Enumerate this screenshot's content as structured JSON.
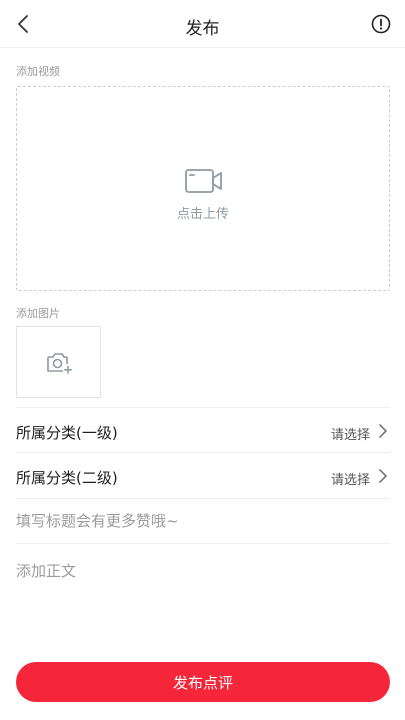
{
  "header": {
    "title": "发布",
    "back_icon": "chevron-left-icon",
    "info_icon": "exclamation-circle-icon"
  },
  "video": {
    "section_label": "添加视频",
    "upload_text": "点击上传",
    "icon": "video-camera-icon"
  },
  "image": {
    "section_label": "添加图片",
    "icon": "camera-add-icon"
  },
  "category1": {
    "label": "所属分类(一级)",
    "value": "请选择"
  },
  "category2": {
    "label": "所属分类(二级)",
    "value": "请选择"
  },
  "title_input": {
    "placeholder": "填写标题会有更多赞哦~"
  },
  "body_input": {
    "placeholder": "添加正文"
  },
  "submit": {
    "label": "发布点评"
  },
  "colors": {
    "accent": "#f5263a",
    "muted": "#9a9a9a",
    "icon": "#8f9aa3"
  }
}
